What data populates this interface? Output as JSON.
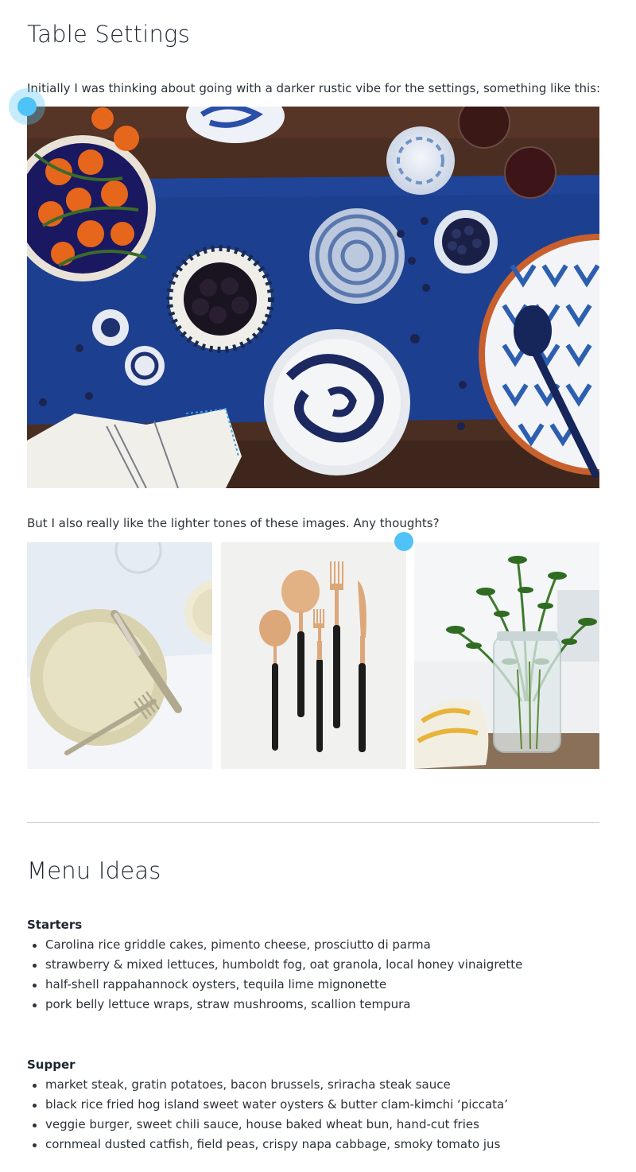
{
  "sections": {
    "table_settings": {
      "title": "Table Settings",
      "intro": "Initially I was thinking about going with a darker rustic vibe for the settings, something like this:",
      "followup": "But I also really like the lighter tones of these images. Any thoughts?"
    },
    "menu_ideas": {
      "title": "Menu Ideas",
      "starters": {
        "heading": "Starters",
        "items": [
          "Carolina rice griddle cakes, pimento cheese, prosciutto di parma",
          "strawberry & mixed lettuces, humboldt fog, oat granola, local honey vinaigrette",
          "half-shell rappahannock oysters, tequila lime mignonette",
          "pork belly lettuce wraps, straw mushrooms, scallion tempura"
        ]
      },
      "supper": {
        "heading": "Supper",
        "items": [
          "market steak, gratin potatoes, bacon brussels, sriracha steak sauce",
          "black rice fried hog island sweet water oysters & butter clam-kimchi ‘piccata’",
          "veggie burger, sweet chili sauce, house baked wheat bun, hand-cut fries",
          "cornmeal dusted catfish, field peas, crispy napa cabbage, smoky tomato jus"
        ]
      }
    }
  },
  "images": {
    "hero": "dark-table-blue-runner-bowls-photo",
    "thumb1": "cream-plate-knife-fork-photo",
    "thumb2": "gold-black-cutlery-photo",
    "thumb3": "herbs-in-jar-photo"
  },
  "colors": {
    "text": "#2d333a",
    "heading": "#1e2530",
    "divider": "#cfd3d7",
    "cursor": "#4fc3f7"
  }
}
